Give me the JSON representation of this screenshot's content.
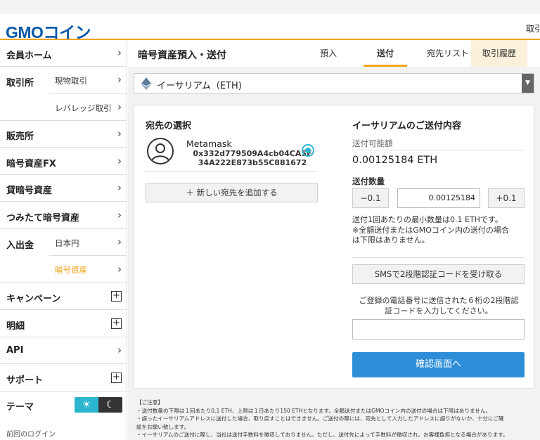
{
  "header": {
    "logo": "GMOコイン",
    "right_text": "取引"
  },
  "sidebar": {
    "member_home": "会員ホーム",
    "trading": "取引所",
    "spot": "現物取引",
    "leverage": "レバレッジ取引",
    "sales": "販売所",
    "crypto_fx": "暗号資産FX",
    "lending": "貸暗号資産",
    "tsumitate": "つみたて暗号資産",
    "deposit_withdraw": "入出金",
    "jpy": "日本円",
    "crypto": "暗号資産",
    "campaign": "キャンペーン",
    "statement": "明細",
    "api": "API",
    "support": "サポート",
    "theme": "テーマ",
    "last_login": "前回のログイン"
  },
  "titlebar": {
    "title": "暗号資産預入・送付",
    "tabs": [
      "預入",
      "送付",
      "宛先リスト",
      "取引履歴"
    ]
  },
  "asset_select": {
    "value": "イーサリアム（ETH)"
  },
  "destination": {
    "heading": "宛先の選択",
    "name": "Metamask",
    "address_line1": "0x332d779509A4cb04CA5E",
    "address_line2": "34A222E873b55C881672",
    "add_label": "＋ 新しい宛先を追加する"
  },
  "send": {
    "heading": "イーサリアムのご送付内容",
    "available_label": "送付可能額",
    "available_value": "0.00125184 ETH",
    "quantity_label": "送付数量",
    "minus_label": "−0.1",
    "quantity_value": "0.00125184",
    "plus_label": "+0.1",
    "note_line1": "送付1回あたりの最小数量は0.1 ETHです。",
    "note_line2": "※全額送付またはGMOコイン内の送付の場合",
    "note_line3": "は下限はありません。",
    "sms_label": "SMSで2段階認証コードを受け取る",
    "sms_desc_line1": "ご登録の電話番号に送信された６桁の2段階認",
    "sms_desc_line2": "証コードを入力してください。",
    "code_placeholder": "",
    "confirm_label": "確認画面へ"
  },
  "notes": {
    "title": "【ご注意】",
    "line1": "・送付数量の下限は１回あたり0.1 ETH、上限は１日あたり150 ETHとなります。全額送付またはGMOコイン内の送付の場合は下限はありません。",
    "line2": "・誤ったイーサリアムアドレスに送付した場合、取り戻すことはできません。ご送付の際には、宛先として入力したアドレスに誤りがないか、十分にご確",
    "line3": "認をお願い致します。",
    "line4": "・イーサリアムのご送付に際し、当社は送付手数料を徴収しておりません。ただし、送付先によって手数料が徴収され、お客様負担となる場合があります。"
  },
  "colors": {
    "brand": "#0a59a8",
    "accent": "#f5a31a",
    "primary_button": "#2e8fd8",
    "radio": "#2bb5cf"
  }
}
